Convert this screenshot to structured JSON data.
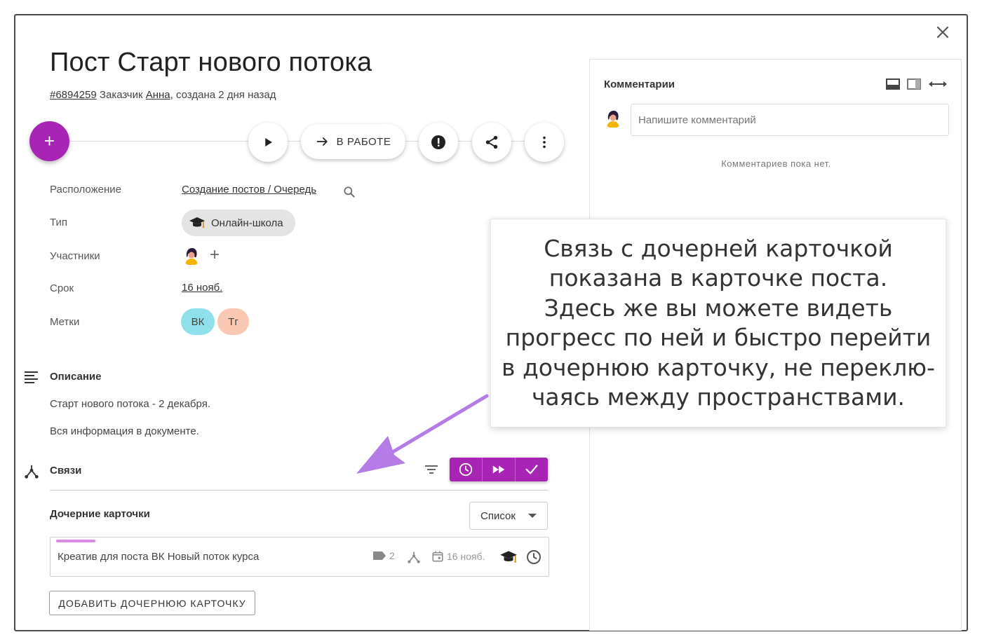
{
  "header": {
    "title": "Пост Старт нового потока",
    "card_id": "#6894259",
    "customer_prefix": "Заказчик",
    "customer_name": "Анна",
    "created": ", создана 2 дня назад"
  },
  "actions": {
    "add_label": "+",
    "status_label": "В РАБОТЕ",
    "icons": [
      "play-icon",
      "arrow-right-icon",
      "alert-icon",
      "share-icon",
      "more-vert-icon"
    ]
  },
  "fields": {
    "location_label": "Расположение",
    "location_value": "Создание постов / Очередь",
    "type_label": "Тип",
    "type_value": "Онлайн-школа",
    "participants_label": "Участники",
    "participants_add": "+",
    "deadline_label": "Срок",
    "deadline_value": "16 нояб.",
    "tags_label": "Метки",
    "tags": [
      {
        "label": "ВК",
        "color": "#8ee0ea"
      },
      {
        "label": "Тг",
        "color": "#fbc8b3"
      }
    ]
  },
  "description": {
    "title": "Описание",
    "lines": [
      "Старт нового потока - 2 декабря.",
      "Вся информация в документе."
    ]
  },
  "links": {
    "title": "Связи",
    "child_cards_title": "Дочерние карточки",
    "view_select": "Список",
    "child_card": {
      "title": "Креатив для поста ВК Новый поток курса",
      "tag_count": "2",
      "date": "16 нояб.",
      "progress": 0.08
    },
    "add_button": "ДОБАВИТЬ ДОЧЕРНЮЮ КАРТОЧКУ"
  },
  "comments": {
    "title": "Комментарии",
    "placeholder": "Напишите комментарий",
    "empty": "Комментариев пока нет."
  },
  "tooltip": {
    "lines": [
      "Связь с дочерней карточкой",
      "показана в карточке поста.",
      "Здесь же вы можете видеть",
      "прогресс по ней и быстро перейти",
      "в дочернюю карточку, не переклю-",
      "чаясь между пространствами."
    ]
  },
  "colors": {
    "accent": "#a824b4",
    "arrow": "#b57be6"
  }
}
